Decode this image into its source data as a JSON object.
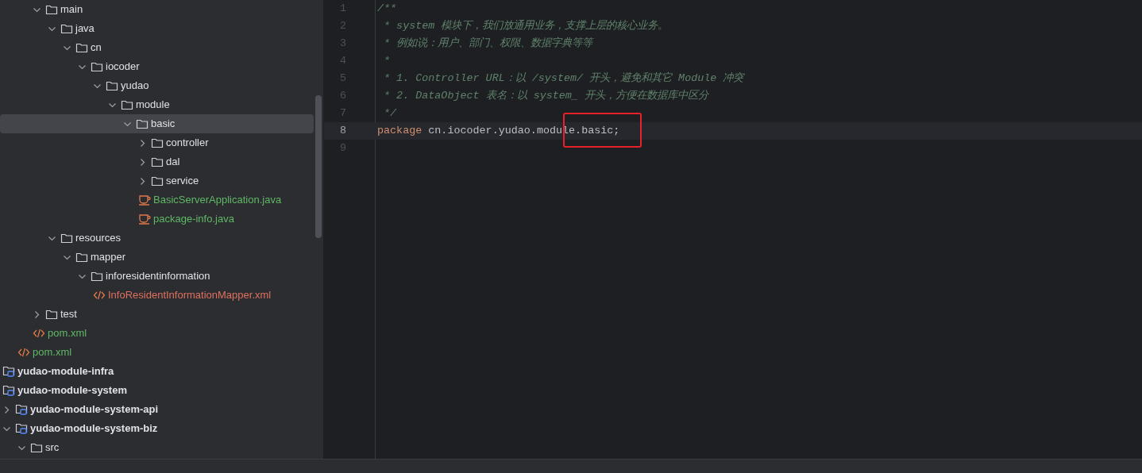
{
  "project_tree": {
    "items": [
      {
        "children": [
          {
            "children": [
              {
                "label": "main",
                "kind": "folder",
                "expanded": true,
                "selected": false,
                "children": [
                  {
                    "label": "java",
                    "kind": "folder",
                    "expanded": true,
                    "selected": false,
                    "children": [
                      {
                        "label": "cn",
                        "kind": "folder",
                        "expanded": true,
                        "selected": false,
                        "children": [
                          {
                            "label": "iocoder",
                            "kind": "folder",
                            "expanded": true,
                            "selected": false,
                            "children": [
                              {
                                "label": "yudao",
                                "kind": "folder",
                                "expanded": true,
                                "selected": false,
                                "children": [
                                  {
                                    "label": "module",
                                    "kind": "folder",
                                    "expanded": true,
                                    "selected": false,
                                    "children": [
                                      {
                                        "label": "basic",
                                        "kind": "folder",
                                        "expanded": true,
                                        "selected": true,
                                        "children": [
                                          {
                                            "label": "controller",
                                            "kind": "folder",
                                            "expanded": false,
                                            "selected": false
                                          },
                                          {
                                            "label": "dal",
                                            "kind": "folder",
                                            "expanded": false,
                                            "selected": false
                                          },
                                          {
                                            "label": "service",
                                            "kind": "folder",
                                            "expanded": false,
                                            "selected": false
                                          },
                                          {
                                            "label": "BasicServerApplication.java",
                                            "kind": "java",
                                            "color": "#5fb865",
                                            "selected": false
                                          },
                                          {
                                            "label": "package-info.java",
                                            "kind": "java",
                                            "color": "#5fb865",
                                            "selected": false
                                          }
                                        ]
                                      }
                                    ]
                                  }
                                ]
                              }
                            ]
                          }
                        ]
                      }
                    ]
                  },
                  {
                    "label": "resources",
                    "kind": "folder",
                    "expanded": true,
                    "selected": false,
                    "children": [
                      {
                        "label": "mapper",
                        "kind": "folder",
                        "expanded": true,
                        "selected": false,
                        "children": [
                          {
                            "label": "inforesidentinformation",
                            "kind": "folder",
                            "expanded": true,
                            "selected": false,
                            "children": [
                              {
                                "label": "InfoResidentInformationMapper.xml",
                                "kind": "xml",
                                "color": "#e0705e",
                                "selected": false
                              }
                            ]
                          }
                        ]
                      }
                    ]
                  }
                ]
              },
              {
                "label": "test",
                "kind": "folder",
                "expanded": false,
                "selected": false
              },
              {
                "label": "pom.xml",
                "kind": "xml",
                "color": "#5fb865",
                "selected": false
              }
            ]
          },
          {
            "label": "pom.xml",
            "kind": "xml",
            "color": "#5fb865",
            "selected": false
          }
        ]
      },
      {
        "label": "yudao-module-infra",
        "kind": "module",
        "selected": false
      },
      {
        "label": "yudao-module-system",
        "kind": "module",
        "selected": false
      },
      {
        "label": "yudao-module-system-api",
        "kind": "module",
        "expanded": false,
        "selected": false
      },
      {
        "label": "yudao-module-system-biz",
        "kind": "module",
        "expanded": true,
        "selected": false,
        "children": [
          {
            "label": "src",
            "kind": "folder",
            "expanded": true,
            "selected": false
          }
        ]
      }
    ]
  },
  "editor": {
    "annotation_box": true,
    "lines": [
      {
        "number": "1",
        "current": false,
        "tokens": [
          {
            "kind": "comment",
            "text": "/**"
          }
        ]
      },
      {
        "number": "2",
        "current": false,
        "tokens": [
          {
            "kind": "comment",
            "text": " * system 模块下，我们放通用业务，支撑上层的核心业务。"
          }
        ]
      },
      {
        "number": "3",
        "current": false,
        "tokens": [
          {
            "kind": "comment",
            "text": " * 例如说：用户、部门、权限、数据字典等等"
          }
        ]
      },
      {
        "number": "4",
        "current": false,
        "tokens": [
          {
            "kind": "comment",
            "text": " *"
          }
        ]
      },
      {
        "number": "5",
        "current": false,
        "tokens": [
          {
            "kind": "comment",
            "text": " * 1. Controller URL：以 /system/ 开头，避免和其它 Module 冲突"
          }
        ]
      },
      {
        "number": "6",
        "current": false,
        "tokens": [
          {
            "kind": "comment",
            "text": " * 2. DataObject 表名：以 system_ 开头，方便在数据库中区分"
          }
        ]
      },
      {
        "number": "7",
        "current": false,
        "tokens": [
          {
            "kind": "comment",
            "text": " */"
          }
        ]
      },
      {
        "number": "8",
        "current": true,
        "tokens": [
          {
            "kind": "keyword",
            "text": "package"
          },
          {
            "kind": "plain",
            "text": " cn.iocoder.yudao.module.basic;"
          }
        ]
      },
      {
        "number": "9",
        "current": false
      }
    ]
  }
}
